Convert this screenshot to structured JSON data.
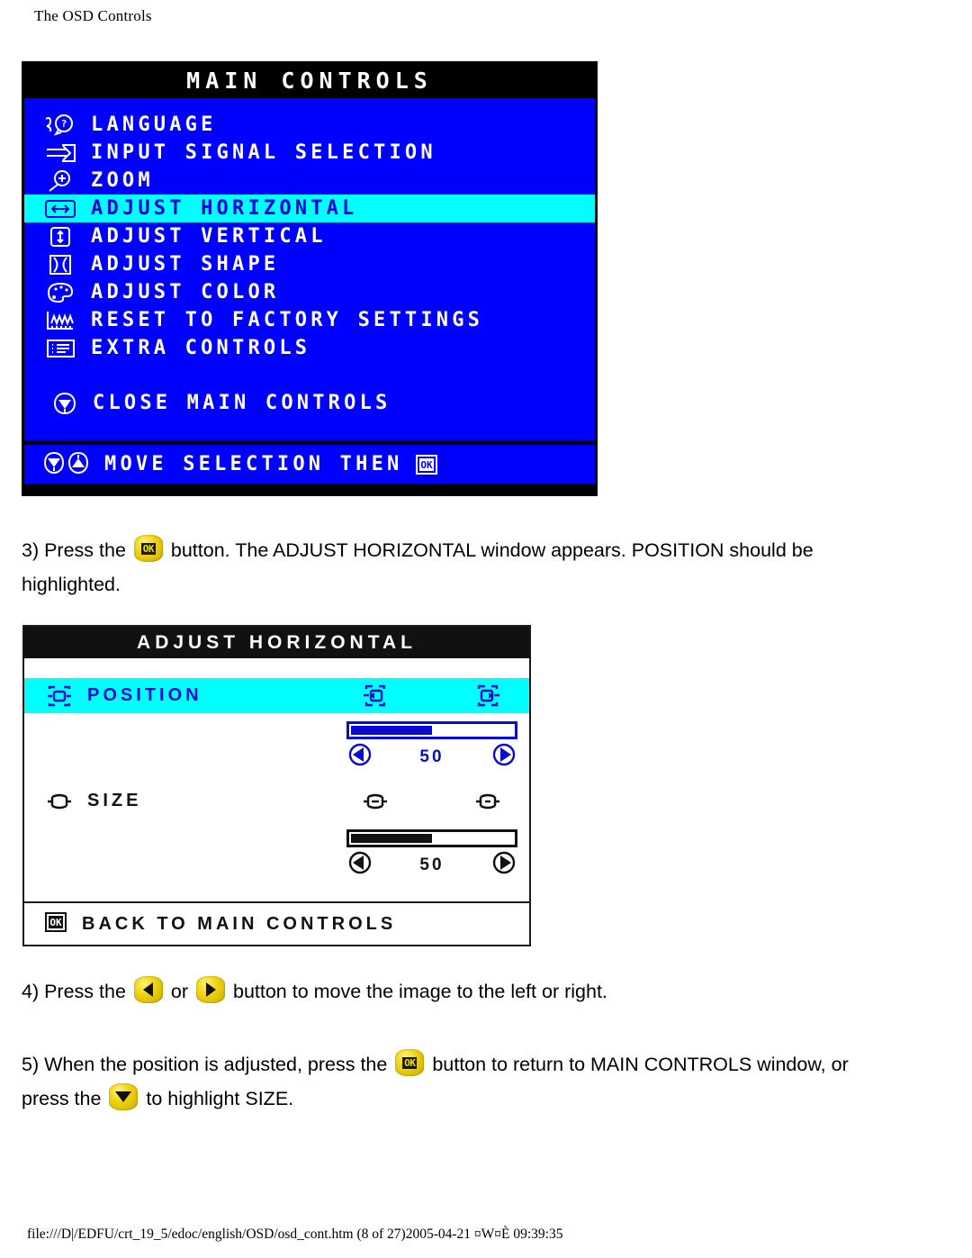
{
  "page": {
    "header_title": "The OSD Controls",
    "footer_path": "file:///D|/EDFU/crt_19_5/edoc/english/OSD/osd_cont.htm (8 of 27)2005-04-21 ¤W¤È 09:39:35"
  },
  "main_controls": {
    "title": "MAIN CONTROLS",
    "items": [
      {
        "icon": "language-icon",
        "label": "LANGUAGE",
        "selected": false
      },
      {
        "icon": "input-signal-icon",
        "label": "INPUT SIGNAL SELECTION",
        "selected": false
      },
      {
        "icon": "zoom-icon",
        "label": "ZOOM",
        "selected": false
      },
      {
        "icon": "adjust-horizontal-icon",
        "label": "ADJUST HORIZONTAL",
        "selected": true
      },
      {
        "icon": "adjust-vertical-icon",
        "label": "ADJUST VERTICAL",
        "selected": false
      },
      {
        "icon": "adjust-shape-icon",
        "label": "ADJUST SHAPE",
        "selected": false
      },
      {
        "icon": "adjust-color-icon",
        "label": "ADJUST COLOR",
        "selected": false
      },
      {
        "icon": "factory-reset-icon",
        "label": "RESET TO FACTORY SETTINGS",
        "selected": false
      },
      {
        "icon": "extra-controls-icon",
        "label": "EXTRA CONTROLS",
        "selected": false
      }
    ],
    "close_item": {
      "icon": "close-down-icon",
      "label": "CLOSE MAIN CONTROLS"
    },
    "footer": {
      "label": "MOVE SELECTION THEN",
      "icons": [
        "down-shield-icon",
        "up-shield-icon"
      ],
      "ok_icon": "ok-icon"
    },
    "colors": {
      "background": "#0000ff",
      "highlight": "#00ffff",
      "title_bar": "#000000",
      "text": "#ffffff"
    }
  },
  "steps": {
    "step3": {
      "pre": "3) Press the",
      "button": "ok-button",
      "post": "button. The ADJUST HORIZONTAL window appears. POSITION should be",
      "line2": "highlighted."
    },
    "step4": {
      "pre": "4) Press the",
      "left_button": "left-arrow-button",
      "mid": "or",
      "right_button": "right-arrow-button",
      "post": "button to move the image to the left or right."
    },
    "step5": {
      "pre": "5) When the position is adjusted, press the",
      "button": "ok-button",
      "post": "button to return to MAIN CONTROLS window, or",
      "line2_pre": "press the",
      "line2_button": "down-arrow-button",
      "line2_post": "to highlight SIZE."
    }
  },
  "adjust_horizontal": {
    "title": "ADJUST HORIZONTAL",
    "rows": [
      {
        "icon": "position-icon",
        "label": "POSITION",
        "highlighted": true,
        "left_icon": "position-left-icon",
        "right_icon": "position-right-icon",
        "value": "50",
        "fill_percent": 50,
        "accent": "#0a0ad0"
      },
      {
        "icon": "size-icon",
        "label": "SIZE",
        "highlighted": false,
        "left_icon": "size-shrink-icon",
        "right_icon": "size-grow-icon",
        "value": "50",
        "fill_percent": 50,
        "accent": "#111111"
      }
    ],
    "footer": {
      "icon": "ok-icon",
      "label": "BACK TO MAIN CONTROLS"
    },
    "colors": {
      "background": "#ffffff",
      "highlight": "#00ffff",
      "title_bar": "#111111",
      "accent_blue": "#0a0ad0"
    }
  }
}
